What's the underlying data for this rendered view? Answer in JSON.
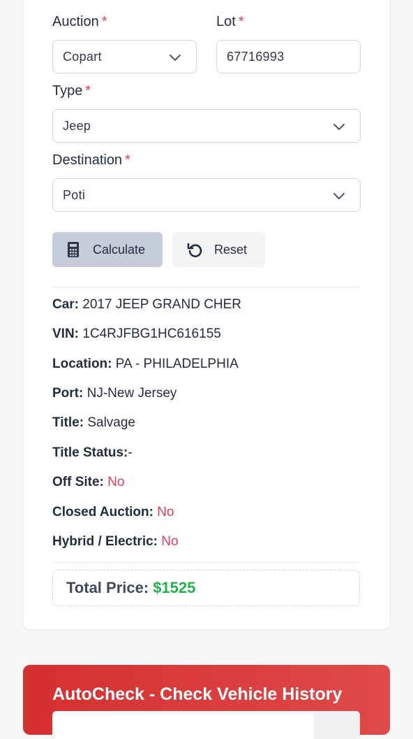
{
  "form": {
    "auction": {
      "label": "Auction",
      "required": "*",
      "value": "Copart"
    },
    "lot": {
      "label": "Lot",
      "required": "*",
      "value": "67716993"
    },
    "type": {
      "label": "Type",
      "required": "*",
      "value": "Jeep"
    },
    "destination": {
      "label": "Destination",
      "required": "*",
      "value": "Poti"
    },
    "calculate_label": "Calculate",
    "reset_label": "Reset"
  },
  "details": {
    "car": {
      "label": "Car:",
      "value": "2017 JEEP GRAND CHER"
    },
    "vin": {
      "label": "VIN:",
      "value": "1C4RJFBG1HC616155"
    },
    "location": {
      "label": "Location:",
      "value": "PA - PHILADELPHIA"
    },
    "port": {
      "label": "Port:",
      "value": "NJ-New Jersey"
    },
    "title": {
      "label": "Title:",
      "value": "Salvage"
    },
    "title_status": {
      "label": "Title Status:",
      "value": "-"
    },
    "off_site": {
      "label": "Off Site:",
      "value": "No"
    },
    "closed_auction": {
      "label": "Closed Auction:",
      "value": "No"
    },
    "hybrid_electric": {
      "label": "Hybrid / Electric:",
      "value": "No"
    }
  },
  "total": {
    "label": "Total Price:",
    "value": "$1525"
  },
  "autocheck": {
    "title": "AutoCheck - Check Vehicle History"
  },
  "colors": {
    "accent_red": "#e23c5a",
    "price_green": "#22b24c",
    "banner_red": "#d52f2f",
    "calc_button": "#c7ccda"
  },
  "icons": {
    "dropdown": "chevron-down-icon",
    "calculate": "calculator-icon",
    "reset": "reset-icon"
  }
}
